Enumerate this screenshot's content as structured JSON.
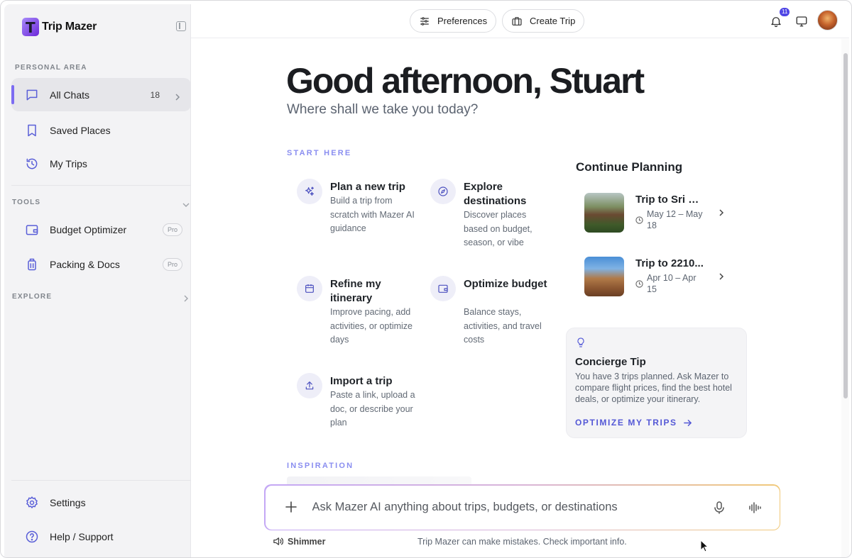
{
  "app": {
    "name": "Trip Mazer",
    "logo_letter": "T"
  },
  "sidebar": {
    "personal_area_label": "PERSONAL AREA",
    "items": [
      {
        "label": "All Chats",
        "count": "18",
        "icon": "chat-icon",
        "active": true
      },
      {
        "label": "Saved Places",
        "icon": "bookmark-icon"
      },
      {
        "label": "My Trips",
        "icon": "history-icon"
      }
    ],
    "tools_label": "TOOLS",
    "tools": [
      {
        "label": "Budget Optimizer",
        "badge": "Pro",
        "icon": "wallet-icon"
      },
      {
        "label": "Packing & Docs",
        "badge": "Pro",
        "icon": "luggage-icon"
      }
    ],
    "explore_label": "EXPLORE",
    "bottom": [
      {
        "label": "Settings",
        "icon": "gear-icon"
      },
      {
        "label": "Help / Support",
        "icon": "help-icon"
      }
    ]
  },
  "topbar": {
    "preferences_label": "Preferences",
    "create_trip_label": "Create Trip",
    "notification_count": "11"
  },
  "main": {
    "greeting": "Good afternoon, Stuart",
    "subtitle": "Where shall we take you today?",
    "start_here_label": "START HERE",
    "cards": [
      {
        "title": "Plan a new trip",
        "desc": "Build a trip from scratch with Mazer AI guidance",
        "icon": "sparkles-icon"
      },
      {
        "title": "Explore destinations",
        "desc": "Discover places based on budget, season, or vibe",
        "icon": "compass-icon"
      },
      {
        "title": "Refine my itinerary",
        "desc": "Improve pacing, add activities, or optimize days",
        "icon": "calendar-icon"
      },
      {
        "title": "Optimize budget",
        "desc": "Balance stays, activities, and travel costs",
        "icon": "wallet-icon"
      },
      {
        "title": "Import a trip",
        "desc": "Paste a link, upload a doc, or describe your plan",
        "icon": "upload-icon"
      }
    ],
    "inspiration_label": "INSPIRATION"
  },
  "continue_planning": {
    "title": "Continue Planning",
    "trips": [
      {
        "title": "Trip to Sri La...",
        "dates": "May 12 – May 18"
      },
      {
        "title": "Trip to 2210...",
        "dates": "Apr 10 – Apr 15"
      }
    ]
  },
  "tip": {
    "title": "Concierge Tip",
    "text": "You have 3 trips planned. Ask Mazer to compare flight prices, find the best hotel deals, or optimize your itinerary.",
    "cta": "OPTIMIZE MY TRIPS"
  },
  "chat": {
    "placeholder": "Ask Mazer AI anything about trips, budgets, or destinations",
    "value": "",
    "voice_label": "Shimmer",
    "disclaimer": "Trip Mazer can make mistakes. Check important info."
  },
  "colors": {
    "accent": "#5458d6",
    "kicker": "#8a8ef0",
    "sidebar_bg": "#f3f3f5",
    "badge_bg": "#4f46e5"
  }
}
